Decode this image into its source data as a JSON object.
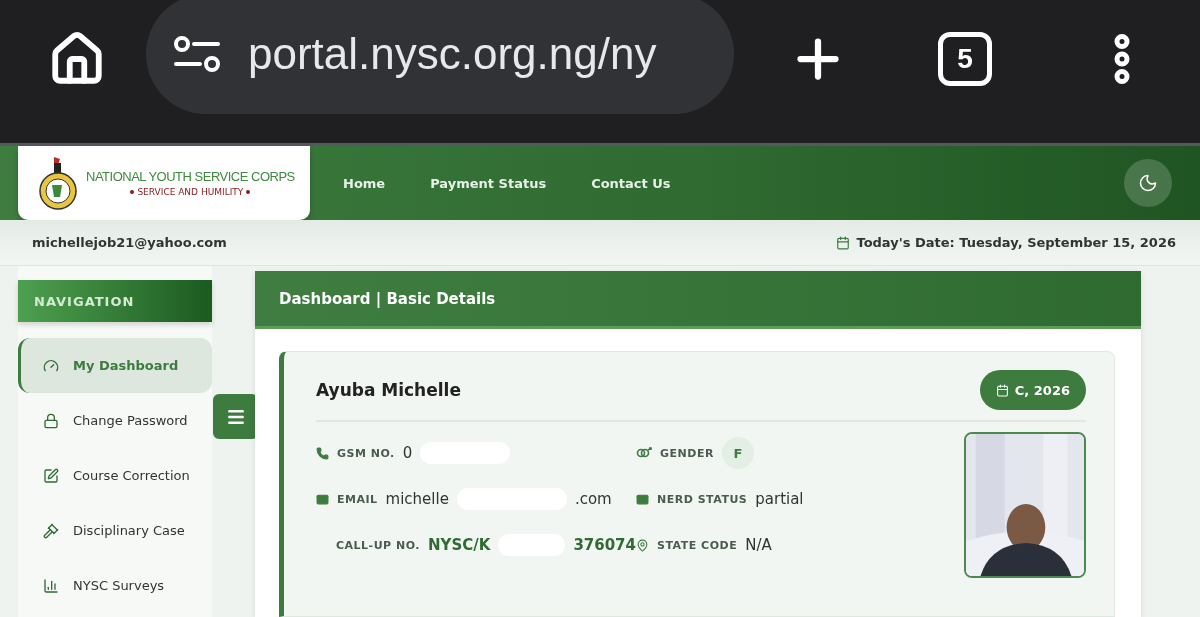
{
  "browser": {
    "url": "portal.nysc.org.ng/ny",
    "tab_count": "5"
  },
  "header": {
    "logo_title": "NATIONAL YOUTH SERVICE CORPS",
    "logo_motto": "SERVICE AND HUMILITY",
    "nav": [
      {
        "label": "Home"
      },
      {
        "label": "Payment Status"
      },
      {
        "label": "Contact Us"
      }
    ]
  },
  "info_bar": {
    "email": "michellejob21@yahoo.com",
    "date": "Today's Date: Tuesday, September 15, 2026"
  },
  "sidebar": {
    "title": "NAVIGATION",
    "items": [
      {
        "label": "My Dashboard",
        "selected": true
      },
      {
        "label": "Change Password",
        "selected": false
      },
      {
        "label": "Course Correction",
        "selected": false
      },
      {
        "label": "Disciplinary Case",
        "selected": false
      },
      {
        "label": "NYSC Surveys",
        "selected": false
      }
    ]
  },
  "panel": {
    "title": "Dashboard | Basic Details"
  },
  "profile": {
    "name": "Ayuba Michelle",
    "batch": "C, 2026",
    "fields": [
      {
        "kind": "phone",
        "label": "GSM NO.",
        "value_parts": [
          "0"
        ]
      },
      {
        "kind": "gender",
        "label": "GENDER",
        "value_parts": [
          "F"
        ]
      },
      {
        "kind": "email",
        "label": "EMAIL",
        "value_parts": [
          "michelle",
          ".com"
        ]
      },
      {
        "kind": "status",
        "label": "NERD STATUS",
        "value_parts": [
          "partial"
        ]
      },
      {
        "kind": "callup",
        "label": "CALL-UP NO.",
        "value_parts": [
          "NYSC/K",
          "376074"
        ]
      },
      {
        "kind": "statecode",
        "label": "STATE CODE",
        "value_parts": [
          "N/A"
        ]
      }
    ]
  }
}
